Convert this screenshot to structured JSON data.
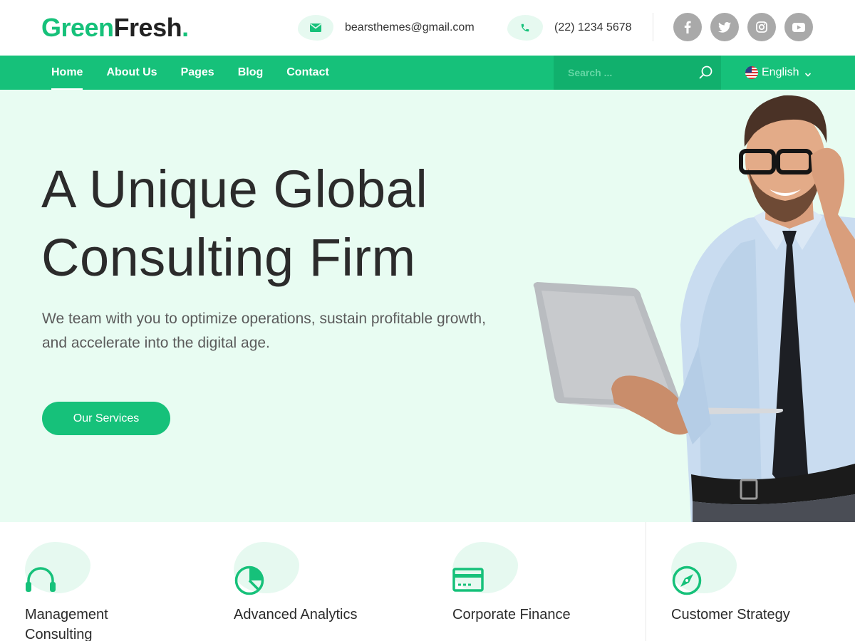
{
  "brand": {
    "part1": "Green",
    "part2": "Fresh",
    "dot": ".",
    "color": "#16c17a"
  },
  "header": {
    "email": {
      "icon": "envelope-icon",
      "text": "bearsthemes@gmail.com"
    },
    "phone": {
      "icon": "phone-icon",
      "text": "(22) 1234 5678"
    },
    "socials": [
      "facebook-icon",
      "twitter-icon",
      "instagram-icon",
      "youtube-icon"
    ]
  },
  "nav": {
    "items": [
      "Home",
      "About Us",
      "Pages",
      "Blog",
      "Contact"
    ],
    "active": "Home",
    "search_placeholder": "Search ...",
    "language": "English"
  },
  "hero": {
    "title_line1": "A Unique Global",
    "title_line2": "Consulting Firm",
    "subtitle": "We team with you to optimize operations, sustain profitable growth, and accelerate into the digital age.",
    "cta": "Our Services"
  },
  "services": [
    {
      "icon": "headset-icon",
      "title": "Management Consulting"
    },
    {
      "icon": "pie-chart-icon",
      "title": "Advanced Analytics"
    },
    {
      "icon": "credit-card-icon",
      "title": "Corporate Finance"
    },
    {
      "icon": "compass-icon",
      "title": "Customer Strategy"
    }
  ],
  "colors": {
    "accent": "#16c17a",
    "hero_bg": "#e8fcf2",
    "social_bg": "#a9a9a9"
  }
}
